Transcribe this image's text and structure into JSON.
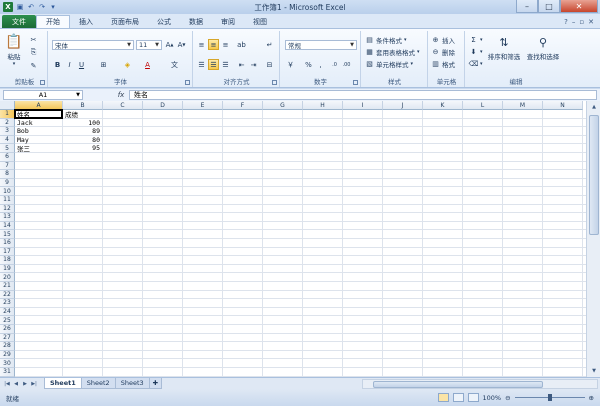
{
  "window": {
    "title": "工作簿1 - Microsoft Excel",
    "min": "–",
    "max": "□",
    "close": "✕"
  },
  "tabs": {
    "file": "文件",
    "items": [
      "开始",
      "插入",
      "页面布局",
      "公式",
      "数据",
      "审阅",
      "视图"
    ],
    "active": "开始"
  },
  "ribbon": {
    "clipboard": {
      "label": "剪贴板",
      "paste": "粘贴"
    },
    "font": {
      "label": "字体",
      "name": "宋体",
      "size": "11"
    },
    "alignment": {
      "label": "对齐方式"
    },
    "number": {
      "label": "数字",
      "format": "常规"
    },
    "styles": {
      "label": "样式",
      "conditional": "条件格式",
      "table": "套用表格格式",
      "cell_styles": "单元格样式"
    },
    "cells": {
      "label": "单元格",
      "insert": "插入",
      "delete": "删除",
      "format": "格式"
    },
    "editing": {
      "label": "编辑",
      "sort_filter": "排序和筛选",
      "find_select": "查找和选择",
      "sum": "Σ"
    }
  },
  "formula_bar": {
    "name_box": "A1",
    "fx": "fx",
    "content": "姓名"
  },
  "columns": [
    "A",
    "B",
    "C",
    "D",
    "E",
    "F",
    "G",
    "H",
    "I",
    "J",
    "K",
    "L",
    "M",
    "N"
  ],
  "rows": [
    "1",
    "2",
    "3",
    "4",
    "5",
    "6",
    "7",
    "8",
    "9",
    "10",
    "11",
    "12",
    "13",
    "14",
    "15",
    "16",
    "17",
    "18",
    "19",
    "20",
    "21",
    "22",
    "23",
    "24",
    "25",
    "26",
    "27",
    "28",
    "29",
    "30",
    "31"
  ],
  "cells": [
    {
      "col": 0,
      "row": 0,
      "value": "姓名",
      "type": "txt"
    },
    {
      "col": 1,
      "row": 0,
      "value": "成绩",
      "type": "txt"
    },
    {
      "col": 0,
      "row": 1,
      "value": "Jack",
      "type": "txt"
    },
    {
      "col": 1,
      "row": 1,
      "value": "100",
      "type": "num"
    },
    {
      "col": 0,
      "row": 2,
      "value": "Bob",
      "type": "txt"
    },
    {
      "col": 1,
      "row": 2,
      "value": "89",
      "type": "num"
    },
    {
      "col": 0,
      "row": 3,
      "value": "May",
      "type": "txt"
    },
    {
      "col": 1,
      "row": 3,
      "value": "80",
      "type": "num"
    },
    {
      "col": 0,
      "row": 4,
      "value": "张三",
      "type": "txt"
    },
    {
      "col": 1,
      "row": 4,
      "value": "95",
      "type": "num"
    }
  ],
  "sheets": {
    "items": [
      "Sheet1",
      "Sheet2",
      "Sheet3"
    ],
    "active": "Sheet1"
  },
  "status": {
    "text": "就绪",
    "zoom": "100%"
  }
}
